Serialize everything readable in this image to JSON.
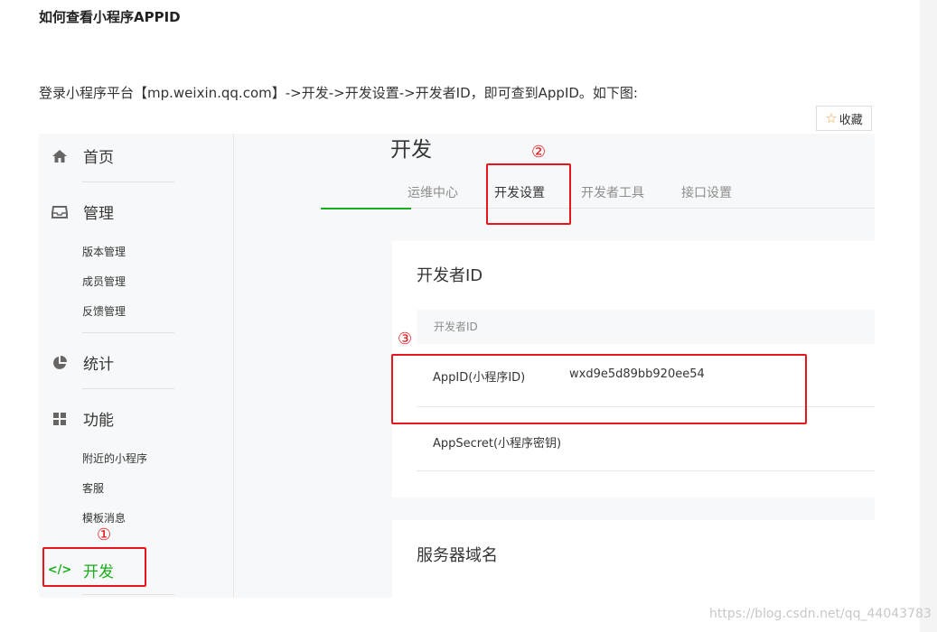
{
  "article": {
    "heading": "如何查看小程序APPID",
    "intro": "登录小程序平台【mp.weixin.qq.com】->开发->开发设置->开发者ID，即可查到AppID。如下图:",
    "collect_label": "收藏",
    "watermark": "https://blog.csdn.net/qq_44043783"
  },
  "sidebar": {
    "home": "首页",
    "manage": "管理",
    "manage_items": [
      "版本管理",
      "成员管理",
      "反馈管理"
    ],
    "stats": "统计",
    "features": "功能",
    "feature_items": [
      "附近的小程序",
      "客服",
      "模板消息"
    ],
    "dev": "开发"
  },
  "main": {
    "title": "开发",
    "tabs": [
      "运维中心",
      "开发设置",
      "开发者工具",
      "接口设置"
    ],
    "active_tab": "开发设置",
    "section_title": "开发者ID",
    "table_header": "开发者ID",
    "rows": [
      {
        "label": "AppID(小程序ID)",
        "value": "wxd9e5d89bb920ee54"
      },
      {
        "label": "AppSecret(小程序密钥)",
        "value": ""
      }
    ],
    "section2_title": "服务器域名"
  },
  "annotations": [
    "①",
    "②",
    "③"
  ],
  "colors": {
    "accent_green": "#1aad19",
    "annotation_red": "#e8161b"
  }
}
